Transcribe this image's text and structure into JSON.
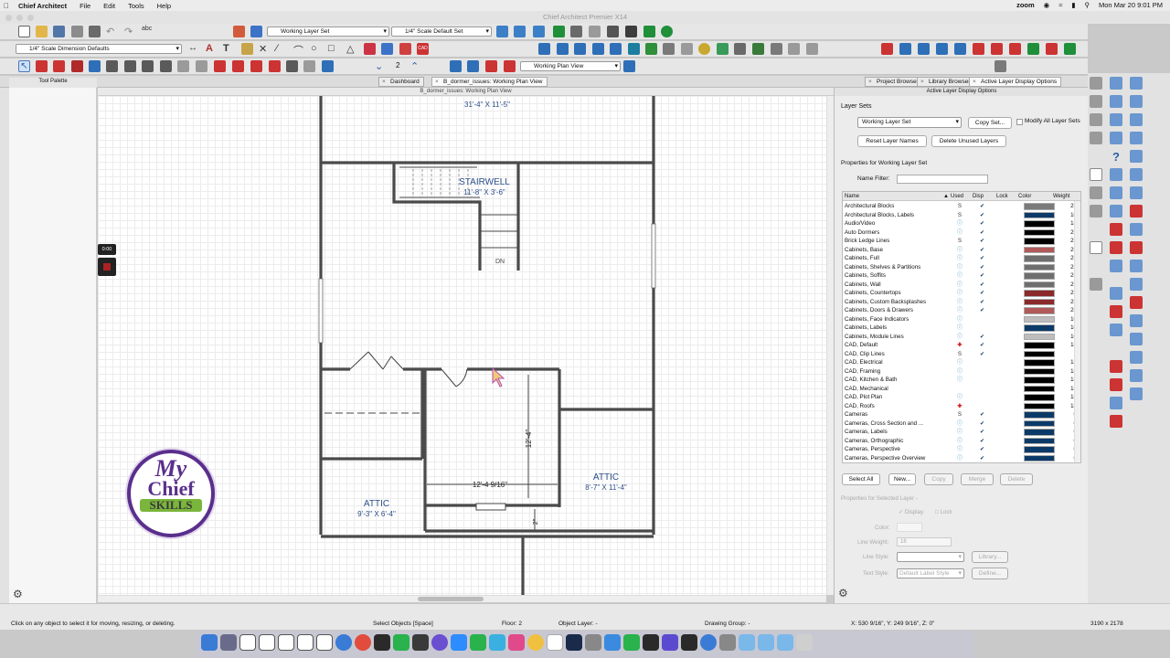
{
  "menubar": {
    "items": [
      "File",
      "Edit",
      "Tools",
      "Help"
    ],
    "app_name": "Chief Architect",
    "zoom": "zoom",
    "datetime": "Mon Mar 20  9:01 PM"
  },
  "window_title": "Chief Architect Premier X14",
  "toolbar": {
    "layer_set": "Working Layer Set",
    "scale_default_set": "1/4\" Scale Default Set",
    "dimension_defaults": "1/4\" Scale Dimension Defaults",
    "step_value": "2",
    "plan_view": "Working Plan View"
  },
  "tool_palette_title": "Tool Palette",
  "tabs": [
    "Dashboard",
    "B_dormer_issues:  Working Plan View"
  ],
  "right_tabs": [
    "Project Browser",
    "Library Browser",
    "Active Layer Display Options"
  ],
  "view_title": "B_dormer_issues:  Working Plan View",
  "recording_timer": "0:00",
  "logo": {
    "line1": "My",
    "line2": "Chief",
    "line3": "SKILLS"
  },
  "plan": {
    "top_room_dims": "31'-4\" X 11'-5\"",
    "stairwell_label": "STAIRWELL",
    "stairwell_dims": "11'-8\" X 3'-6\"",
    "dn_label": "DN",
    "attic_left_label": "ATTIC",
    "attic_left_dims": "9'-3\" X 6'-4\"",
    "attic_right_label": "ATTIC",
    "attic_right_dims": "8'-7\" X 11'-4\"",
    "dim_horizontal": "12'-4 9/16\"",
    "dim_vertical": "12'-4\"",
    "dim_small": "2\""
  },
  "panel": {
    "title": "Active Layer Display Options",
    "layer_sets_label": "Layer Sets",
    "layer_set_value": "Working Layer Set",
    "copy_set": "Copy Set...",
    "modify_all": "Modify All Layer Sets",
    "reset_names": "Reset Layer Names",
    "delete_unused": "Delete Unused Layers",
    "properties_for": "Properties for  Working Layer Set",
    "name_filter": "Name Filter:",
    "columns": [
      "Name",
      "Used",
      "Disp",
      "Lock",
      "Color",
      "Weight"
    ],
    "layers": [
      {
        "name": "Architectural Blocks",
        "used": "S",
        "disp": true,
        "color": "#7a7a7a",
        "weight": "25"
      },
      {
        "name": "Architectural Blocks, Labels",
        "used": "S",
        "disp": true,
        "color": "#0c3a68",
        "weight": "10"
      },
      {
        "name": "Audio/Video",
        "used": "i",
        "disp": true,
        "color": "#000000",
        "weight": "18"
      },
      {
        "name": "Auto Dormers",
        "used": "i",
        "disp": true,
        "color": "#000000",
        "weight": "25"
      },
      {
        "name": "Brick Ledge Lines",
        "used": "S",
        "disp": true,
        "color": "#000000",
        "weight": "25"
      },
      {
        "name": "Cabinets,  Base",
        "used": "i",
        "disp": true,
        "color": "#b05a5a",
        "weight": "25"
      },
      {
        "name": "Cabinets,  Full",
        "used": "i",
        "disp": true,
        "color": "#6e6e6e",
        "weight": "25"
      },
      {
        "name": "Cabinets,  Shelves & Partitions",
        "used": "i",
        "disp": true,
        "color": "#6e6e6e",
        "weight": "25"
      },
      {
        "name": "Cabinets,  Soffits",
        "used": "i",
        "disp": true,
        "color": "#6e6e6e",
        "weight": "25"
      },
      {
        "name": "Cabinets,  Wall",
        "used": "i",
        "disp": true,
        "color": "#6e6e6e",
        "weight": "25"
      },
      {
        "name": "Cabinets, Countertops",
        "used": "i",
        "disp": true,
        "color": "#8b2a2a",
        "weight": "25"
      },
      {
        "name": "Cabinets, Custom Backsplashes",
        "used": "i",
        "disp": true,
        "color": "#8b2a2a",
        "weight": "25"
      },
      {
        "name": "Cabinets, Doors & Drawers",
        "used": "i",
        "disp": true,
        "color": "#b05a5a",
        "weight": "25"
      },
      {
        "name": "Cabinets, Face Indicators",
        "used": "i",
        "disp": false,
        "color": "#bdbdbd",
        "weight": "10"
      },
      {
        "name": "Cabinets, Labels",
        "used": "i",
        "disp": false,
        "color": "#0c3a68",
        "weight": "10"
      },
      {
        "name": "Cabinets, Module Lines",
        "used": "i",
        "disp": true,
        "color": "#bdbdbd",
        "weight": "10"
      },
      {
        "name": "CAD,  Default",
        "used": "+",
        "disp": true,
        "color": "#000000",
        "weight": "18"
      },
      {
        "name": "CAD, Clip Lines",
        "used": "S",
        "disp": true,
        "color": "#000000",
        "weight": "1"
      },
      {
        "name": "CAD, Electrical",
        "used": "i",
        "disp": false,
        "color": "#000000",
        "weight": "18"
      },
      {
        "name": "CAD, Framing",
        "used": "i",
        "disp": false,
        "color": "#000000",
        "weight": "18"
      },
      {
        "name": "CAD, Kitchen & Bath",
        "used": "i",
        "disp": false,
        "color": "#000000",
        "weight": "18"
      },
      {
        "name": "CAD, Mechanical",
        "used": "",
        "disp": false,
        "color": "#000000",
        "weight": "18"
      },
      {
        "name": "CAD, Plot Plan",
        "used": "i",
        "disp": false,
        "color": "#000000",
        "weight": "18"
      },
      {
        "name": "CAD, Roofs",
        "used": "+",
        "disp": false,
        "color": "#000000",
        "weight": "18"
      },
      {
        "name": "Cameras",
        "used": "S",
        "disp": true,
        "color": "#0c3a68",
        "weight": "0"
      },
      {
        "name": "Cameras, Cross Section and ...",
        "used": "i",
        "disp": true,
        "color": "#0c3a68",
        "weight": "0"
      },
      {
        "name": "Cameras, Labels",
        "used": "i",
        "disp": true,
        "color": "#0c3a68",
        "weight": "0"
      },
      {
        "name": "Cameras, Orthographic",
        "used": "i",
        "disp": true,
        "color": "#0c3a68",
        "weight": "0"
      },
      {
        "name": "Cameras, Perspective",
        "used": "i",
        "disp": true,
        "color": "#0c3a68",
        "weight": "0"
      },
      {
        "name": "Cameras, Perspective Overview",
        "used": "i",
        "disp": true,
        "color": "#0c3a68",
        "weight": "0"
      }
    ],
    "select_all": "Select All",
    "new": "New...",
    "copy": "Copy",
    "merge": "Merge",
    "delete": "Delete",
    "props_selected": "Properties for Selected Layer -",
    "display": "Display",
    "lock": "Lock",
    "color": "Color:",
    "line_weight": "Line Weight:",
    "line_weight_value": "18",
    "line_style": "Line Style:",
    "text_style": "Text Style:",
    "text_style_value": "Default Label Style",
    "library": "Library...",
    "define": "Define..."
  },
  "status": {
    "hint": "Click on any object to select it for moving, resizing, or deleting.",
    "mode": "Select Objects [Space]",
    "floor": "Floor: 2",
    "object_layer": "Object Layer: -",
    "drawing_group": "Drawing Group: -",
    "coords": "X: 530 9/16\", Y: 249 9/16\", Z: 0\"",
    "size": "3190 x 2178"
  }
}
